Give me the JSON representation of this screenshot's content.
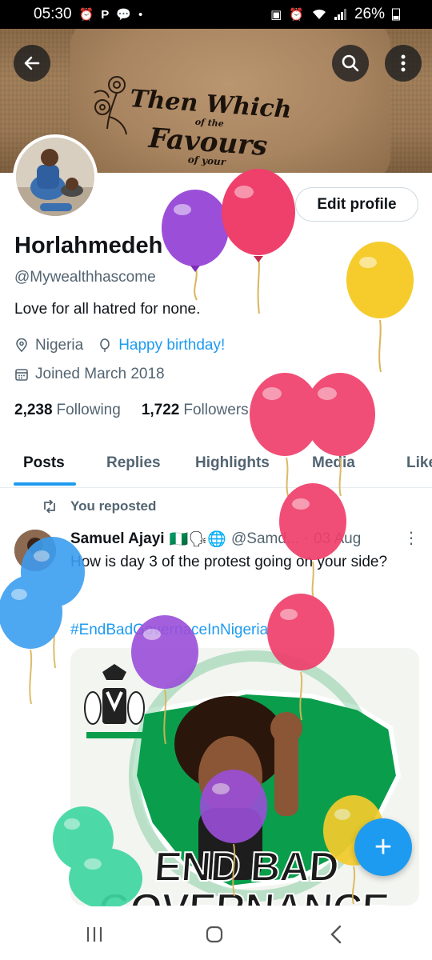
{
  "status_bar": {
    "time": "05:30",
    "battery": "26%",
    "left_icons": [
      "alarm-icon",
      "p-icon",
      "chat-icon",
      "dot-icon"
    ],
    "right_icons": [
      "nfc-icon",
      "alarm-icon",
      "wifi-icon",
      "signal-icon",
      "battery-icon"
    ]
  },
  "banner": {
    "line1": "Then Which",
    "line2": "of the",
    "line3": "Favours",
    "line4": "of your"
  },
  "profile": {
    "edit_label": "Edit profile",
    "name": "Horlahmedeh",
    "handle": "@Mywealthhascome",
    "bio": "Love for all hatred for none.",
    "location": "Nigeria",
    "website": "Happy birthday!",
    "joined": "Joined March 2018",
    "following_count": "2,238",
    "following_label": "Following",
    "followers_count": "1,722",
    "followers_label": "Followers"
  },
  "tabs": [
    {
      "label": "Posts"
    },
    {
      "label": "Replies"
    },
    {
      "label": "Highlights"
    },
    {
      "label": "Media"
    },
    {
      "label": "Likes"
    }
  ],
  "post": {
    "repost_label": "You reposted",
    "author": "Samuel Ajayi",
    "author_emojis": "🇳🇬🗣🌐",
    "author_handle": "@Samd...",
    "separator": "·",
    "date": "03 Aug",
    "text": "How is day 3 of the protest going on your side?",
    "hashtag": "#EndBadGovernaceInNigeria",
    "image_text": "END BAD GOVERNANCE"
  },
  "fab_label": "+",
  "colors": {
    "accent": "#1d9bf0",
    "text": "#0f1419",
    "muted": "#536471",
    "nigeria_green": "#0a9e4c"
  }
}
